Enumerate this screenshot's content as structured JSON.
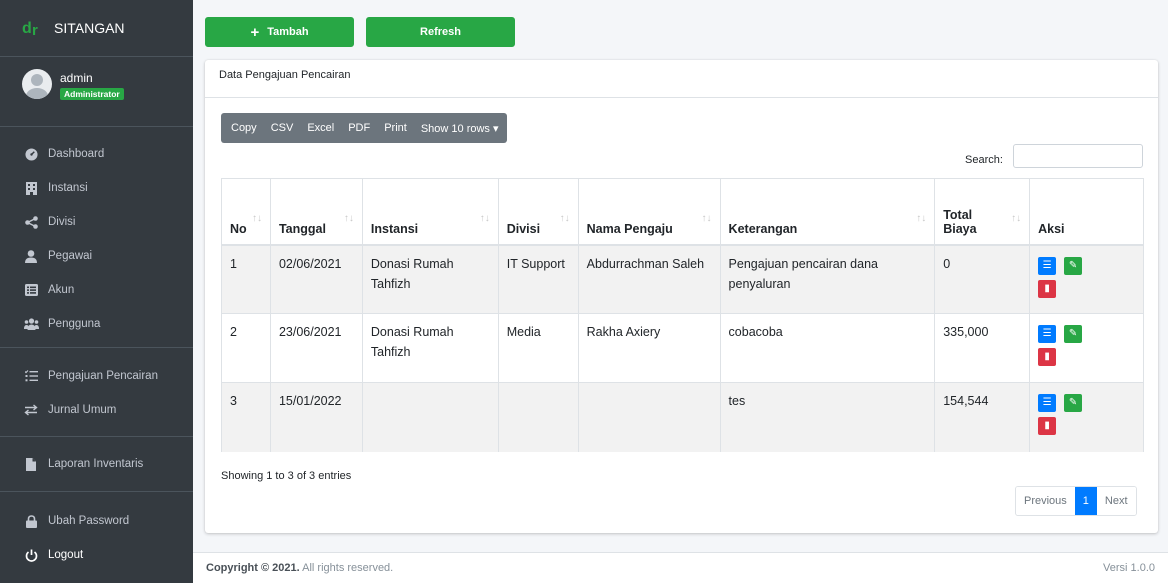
{
  "brand": {
    "name": "SITANGAN",
    "logo_color": "#28a745"
  },
  "user": {
    "name": "admin",
    "role": "Administrator"
  },
  "sidebar": {
    "items": [
      {
        "label": "Dashboard",
        "icon": "dashboard-icon"
      },
      {
        "label": "Instansi",
        "icon": "building-icon"
      },
      {
        "label": "Divisi",
        "icon": "share-icon"
      },
      {
        "label": "Pegawai",
        "icon": "user-icon"
      },
      {
        "label": "Akun",
        "icon": "list-alt-icon"
      },
      {
        "label": "Pengguna",
        "icon": "users-icon"
      },
      {
        "label": "Pengajuan Pencairan",
        "icon": "list-icon"
      },
      {
        "label": "Jurnal Umum",
        "icon": "exchange-icon"
      },
      {
        "label": "Laporan Inventaris",
        "icon": "file-icon"
      },
      {
        "label": "Ubah Password",
        "icon": "lock-icon"
      },
      {
        "label": "Logout",
        "icon": "power-icon"
      }
    ]
  },
  "toolbar": {
    "add_label": "Tambah",
    "refresh_label": "Refresh"
  },
  "card": {
    "title": "Data Pengajuan Pencairan"
  },
  "export_buttons": [
    "Copy",
    "CSV",
    "Excel",
    "PDF",
    "Print",
    "Show 10 rows ▾"
  ],
  "search": {
    "label": "Search:",
    "value": ""
  },
  "table": {
    "headers": [
      "No",
      "Tanggal",
      "Instansi",
      "Divisi",
      "Nama Pengaju",
      "Keterangan",
      "Total Biaya",
      "Aksi"
    ],
    "rows": [
      [
        "1",
        "02/06/2021",
        "Donasi Rumah Tahfizh",
        "IT Support",
        "Abdurrachman Saleh",
        "Pengajuan pencairan dana penyaluran",
        "0"
      ],
      [
        "2",
        "23/06/2021",
        "Donasi Rumah Tahfizh",
        "Media",
        "Rakha Axiery",
        "cobacoba",
        "335,000"
      ],
      [
        "3",
        "15/01/2022",
        "",
        "",
        "",
        "tes",
        "154,544"
      ]
    ]
  },
  "info": "Showing 1 to 3 of 3 entries",
  "pagination": {
    "previous": "Previous",
    "current": "1",
    "next": "Next"
  },
  "footer": {
    "copyright": "Copyright © 2021.",
    "rights": "All rights reserved.",
    "version": "Versi 1.0.0"
  }
}
